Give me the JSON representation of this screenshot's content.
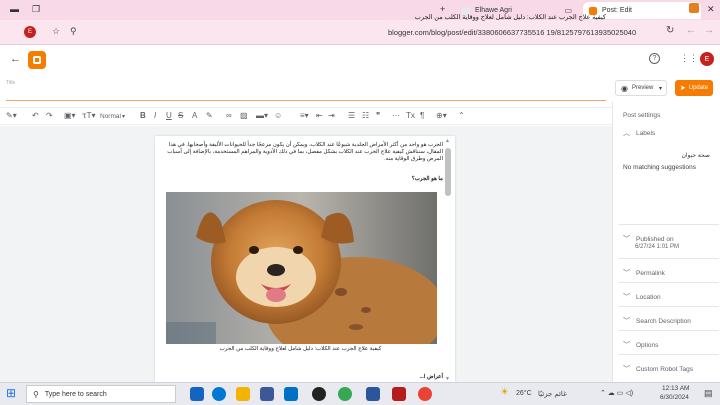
{
  "browser": {
    "tabs": [
      {
        "label": "Elhawe Agri"
      },
      {
        "label": "Post: Edit"
      }
    ],
    "new_tab": "+",
    "url": "blogger.com/blog/post/edit/3380606637735516 19/8125797613935025040",
    "url_display": "blogger.com/blog/post/edit/3380606637735516 19/8125797613935025040",
    "profile_initial": "E"
  },
  "blogger": {
    "avatar_initial": "E",
    "title_label": "Title",
    "post_title": "كيفية علاج الجرب عند الكلاب: دليل شامل لعلاج ووقاية الكلب من الجرب",
    "preview_label": "Preview",
    "update_label": "Update",
    "format_select": "Normal"
  },
  "content": {
    "intro": "الجرب هو واحد من أكثر الأمراض الجلدية شيوعًا عند الكلاب، ويمكن أن يكون مزعجًا جداً للحيوانات الأليفة وأصحابها. في هذا المقال، سنناقش كيفية علاج الجرب عند الكلاب بشكل مفصل، بما في ذلك الأدوية والمراهم المستخدمة، بالإضافة إلى أسباب المرض وطرق الوقاية منه.",
    "heading": "ما هو الجرب؟",
    "caption": "كيفية علاج الجرب عند الكلاب: دليل شامل لعلاج ووقاية الكلب من الجرب",
    "after": "أعراض ا..."
  },
  "sidebar": {
    "post_settings": "Post settings",
    "labels": "Labels",
    "label_input": "صحة حيوان",
    "no_match": "No matching suggestions",
    "published_on": "Published on",
    "published_date": "6/27/24 1:01 PM",
    "permalink": "Permalink",
    "location": "Location",
    "search_description": "Search Description",
    "options": "Options",
    "custom_robot_tags": "Custom Robot Tags"
  },
  "taskbar": {
    "search_placeholder": "Type here to search",
    "weather_temp": "26°C",
    "weather_text": "غائم جزئيًا",
    "time": "12:13 AM",
    "date": "6/30/2024"
  },
  "colors": {
    "chrome": "#f7d9e8",
    "accent": "#f57c00",
    "profile": "#c5221f"
  }
}
